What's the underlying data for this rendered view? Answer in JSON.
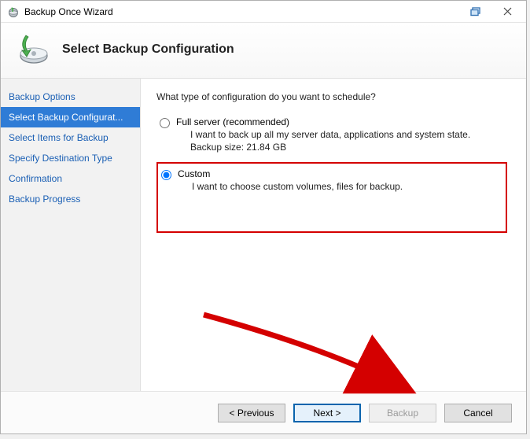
{
  "window": {
    "title": "Backup Once Wizard"
  },
  "header": {
    "heading": "Select Backup Configuration"
  },
  "sidebar": {
    "steps": [
      {
        "label": "Backup Options"
      },
      {
        "label": "Select Backup Configurat..."
      },
      {
        "label": "Select Items for Backup"
      },
      {
        "label": "Specify Destination Type"
      },
      {
        "label": "Confirmation"
      },
      {
        "label": "Backup Progress"
      }
    ],
    "selected_index": 1
  },
  "content": {
    "prompt": "What type of configuration do you want to schedule?",
    "options": {
      "full": {
        "label": "Full server (recommended)",
        "desc": "I want to back up all my server data, applications and system state.",
        "size": "Backup size: 21.84 GB"
      },
      "custom": {
        "label": "Custom",
        "desc": "I want to choose custom volumes, files for backup."
      }
    },
    "selected": "custom"
  },
  "footer": {
    "previous": "< Previous",
    "next": "Next >",
    "backup": "Backup",
    "cancel": "Cancel"
  }
}
